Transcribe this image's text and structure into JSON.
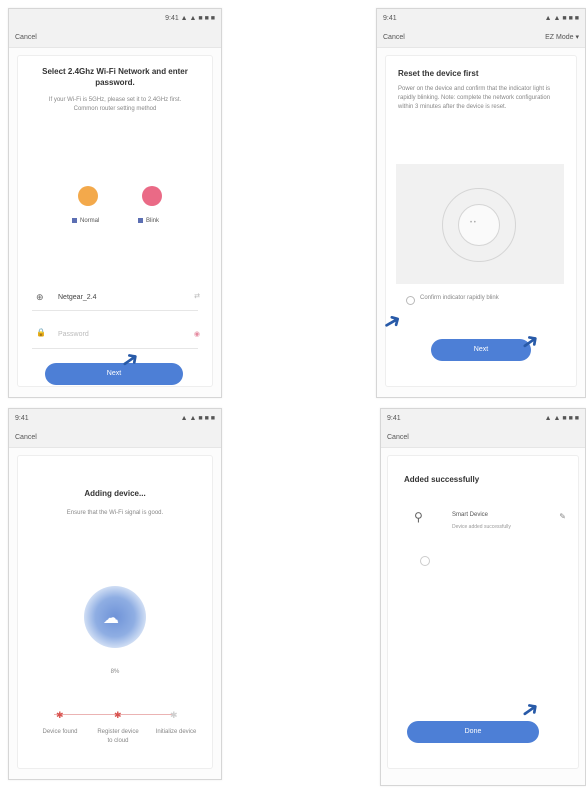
{
  "screens": [
    {
      "status_left": "",
      "status_right": "9:41 ▲ ▲ ■ ■ ■",
      "nav_left": "Cancel",
      "title": "Select 2.4Ghz Wi-Fi Network and enter password.",
      "subtitle": "If your Wi-Fi is 5GHz, please set it to 2.4GHz first. Common router setting method",
      "link": "Common router setting method",
      "option_left": "Normal",
      "option_right": "Blink",
      "wifi_name": "Netgear_2.4",
      "password_placeholder": "Password",
      "button": "Next"
    },
    {
      "status_left": "9:41",
      "status_right": "▲ ▲ ■ ■ ■",
      "nav_left": "Cancel",
      "nav_right": "EZ Mode ▾",
      "title": "Reset the device first",
      "body": "Power on the device and confirm that the indicator light is rapidly blinking. Note: complete the network configuration within 3 minutes after the device is reset.",
      "checkbox_label": "Confirm indicator rapidly blink",
      "button": "Next"
    },
    {
      "status_left": "9:41",
      "status_right": "▲ ▲ ■ ■ ■",
      "nav_left": "Cancel",
      "title": "Adding device...",
      "subtitle": "Ensure that the Wi-Fi signal is good.",
      "percent": "8%",
      "steps": [
        "Device found",
        "Register device to cloud",
        "Initialize device"
      ]
    },
    {
      "status_left": "9:41",
      "status_right": "▲ ▲ ■ ■ ■",
      "nav_left": "Cancel",
      "title": "Added successfully",
      "device_name": "Smart Device",
      "device_sub": "Device added successfully",
      "button": "Done"
    }
  ],
  "colors": {
    "accent": "#4d7fd6",
    "orange": "#f3a94b",
    "pink": "#ea6a86",
    "red": "#d9534f",
    "arrow": "#285aa8"
  }
}
